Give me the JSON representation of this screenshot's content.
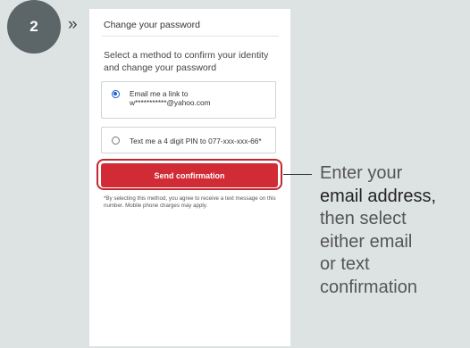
{
  "step": {
    "number": "2",
    "arrows": "»"
  },
  "card": {
    "title": "Change your password",
    "instructions": "Select a method to confirm your identity and change your password",
    "options": [
      {
        "label_line1": "Email me a link to",
        "label_line2": "w***********@yahoo.com",
        "selected": true
      },
      {
        "label": "Text me a 4 digit PIN to 077-xxx-xxx-66*",
        "selected": false
      }
    ],
    "button_label": "Send confirmation",
    "disclaimer": "*By selecting this method, you agree to receive a text message on this number. Mobile phone charges may apply."
  },
  "callout": {
    "line1": "Enter your",
    "line2": "email address,",
    "line3": "then select",
    "line4": "either email",
    "line5": "or text",
    "line6": "confirmation"
  },
  "colors": {
    "accent_red": "#d12b35",
    "radio_blue": "#1a5fd0",
    "badge_gray": "#5c6568",
    "background": "#dde3e2"
  }
}
